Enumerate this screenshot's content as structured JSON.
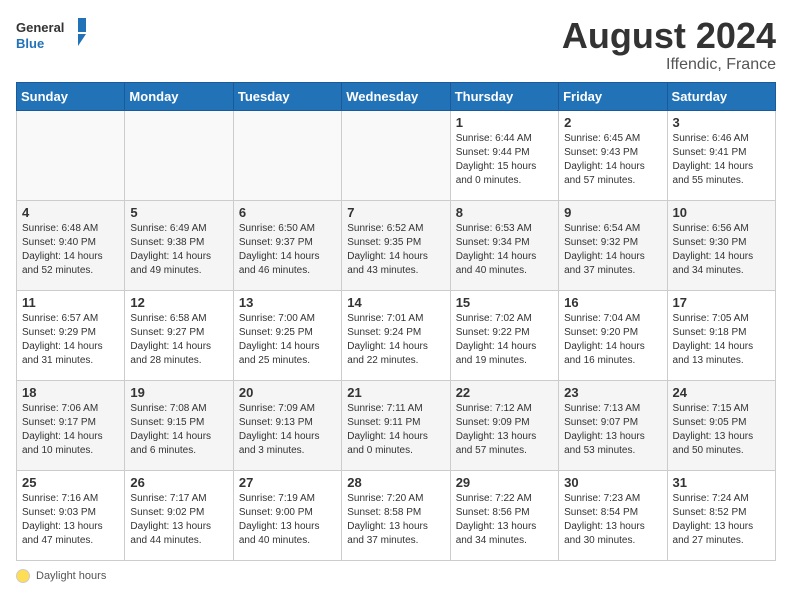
{
  "logo": {
    "text_general": "General",
    "text_blue": "Blue"
  },
  "title": {
    "month_year": "August 2024",
    "location": "Iffendic, France"
  },
  "calendar": {
    "days_header": [
      "Sunday",
      "Monday",
      "Tuesday",
      "Wednesday",
      "Thursday",
      "Friday",
      "Saturday"
    ],
    "weeks": [
      [
        {
          "day": "",
          "info": ""
        },
        {
          "day": "",
          "info": ""
        },
        {
          "day": "",
          "info": ""
        },
        {
          "day": "",
          "info": ""
        },
        {
          "day": "1",
          "info": "Sunrise: 6:44 AM\nSunset: 9:44 PM\nDaylight: 15 hours and 0 minutes."
        },
        {
          "day": "2",
          "info": "Sunrise: 6:45 AM\nSunset: 9:43 PM\nDaylight: 14 hours and 57 minutes."
        },
        {
          "day": "3",
          "info": "Sunrise: 6:46 AM\nSunset: 9:41 PM\nDaylight: 14 hours and 55 minutes."
        }
      ],
      [
        {
          "day": "4",
          "info": "Sunrise: 6:48 AM\nSunset: 9:40 PM\nDaylight: 14 hours and 52 minutes."
        },
        {
          "day": "5",
          "info": "Sunrise: 6:49 AM\nSunset: 9:38 PM\nDaylight: 14 hours and 49 minutes."
        },
        {
          "day": "6",
          "info": "Sunrise: 6:50 AM\nSunset: 9:37 PM\nDaylight: 14 hours and 46 minutes."
        },
        {
          "day": "7",
          "info": "Sunrise: 6:52 AM\nSunset: 9:35 PM\nDaylight: 14 hours and 43 minutes."
        },
        {
          "day": "8",
          "info": "Sunrise: 6:53 AM\nSunset: 9:34 PM\nDaylight: 14 hours and 40 minutes."
        },
        {
          "day": "9",
          "info": "Sunrise: 6:54 AM\nSunset: 9:32 PM\nDaylight: 14 hours and 37 minutes."
        },
        {
          "day": "10",
          "info": "Sunrise: 6:56 AM\nSunset: 9:30 PM\nDaylight: 14 hours and 34 minutes."
        }
      ],
      [
        {
          "day": "11",
          "info": "Sunrise: 6:57 AM\nSunset: 9:29 PM\nDaylight: 14 hours and 31 minutes."
        },
        {
          "day": "12",
          "info": "Sunrise: 6:58 AM\nSunset: 9:27 PM\nDaylight: 14 hours and 28 minutes."
        },
        {
          "day": "13",
          "info": "Sunrise: 7:00 AM\nSunset: 9:25 PM\nDaylight: 14 hours and 25 minutes."
        },
        {
          "day": "14",
          "info": "Sunrise: 7:01 AM\nSunset: 9:24 PM\nDaylight: 14 hours and 22 minutes."
        },
        {
          "day": "15",
          "info": "Sunrise: 7:02 AM\nSunset: 9:22 PM\nDaylight: 14 hours and 19 minutes."
        },
        {
          "day": "16",
          "info": "Sunrise: 7:04 AM\nSunset: 9:20 PM\nDaylight: 14 hours and 16 minutes."
        },
        {
          "day": "17",
          "info": "Sunrise: 7:05 AM\nSunset: 9:18 PM\nDaylight: 14 hours and 13 minutes."
        }
      ],
      [
        {
          "day": "18",
          "info": "Sunrise: 7:06 AM\nSunset: 9:17 PM\nDaylight: 14 hours and 10 minutes."
        },
        {
          "day": "19",
          "info": "Sunrise: 7:08 AM\nSunset: 9:15 PM\nDaylight: 14 hours and 6 minutes."
        },
        {
          "day": "20",
          "info": "Sunrise: 7:09 AM\nSunset: 9:13 PM\nDaylight: 14 hours and 3 minutes."
        },
        {
          "day": "21",
          "info": "Sunrise: 7:11 AM\nSunset: 9:11 PM\nDaylight: 14 hours and 0 minutes."
        },
        {
          "day": "22",
          "info": "Sunrise: 7:12 AM\nSunset: 9:09 PM\nDaylight: 13 hours and 57 minutes."
        },
        {
          "day": "23",
          "info": "Sunrise: 7:13 AM\nSunset: 9:07 PM\nDaylight: 13 hours and 53 minutes."
        },
        {
          "day": "24",
          "info": "Sunrise: 7:15 AM\nSunset: 9:05 PM\nDaylight: 13 hours and 50 minutes."
        }
      ],
      [
        {
          "day": "25",
          "info": "Sunrise: 7:16 AM\nSunset: 9:03 PM\nDaylight: 13 hours and 47 minutes."
        },
        {
          "day": "26",
          "info": "Sunrise: 7:17 AM\nSunset: 9:02 PM\nDaylight: 13 hours and 44 minutes."
        },
        {
          "day": "27",
          "info": "Sunrise: 7:19 AM\nSunset: 9:00 PM\nDaylight: 13 hours and 40 minutes."
        },
        {
          "day": "28",
          "info": "Sunrise: 7:20 AM\nSunset: 8:58 PM\nDaylight: 13 hours and 37 minutes."
        },
        {
          "day": "29",
          "info": "Sunrise: 7:22 AM\nSunset: 8:56 PM\nDaylight: 13 hours and 34 minutes."
        },
        {
          "day": "30",
          "info": "Sunrise: 7:23 AM\nSunset: 8:54 PM\nDaylight: 13 hours and 30 minutes."
        },
        {
          "day": "31",
          "info": "Sunrise: 7:24 AM\nSunset: 8:52 PM\nDaylight: 13 hours and 27 minutes."
        }
      ]
    ]
  },
  "legend": {
    "label": "Daylight hours"
  }
}
